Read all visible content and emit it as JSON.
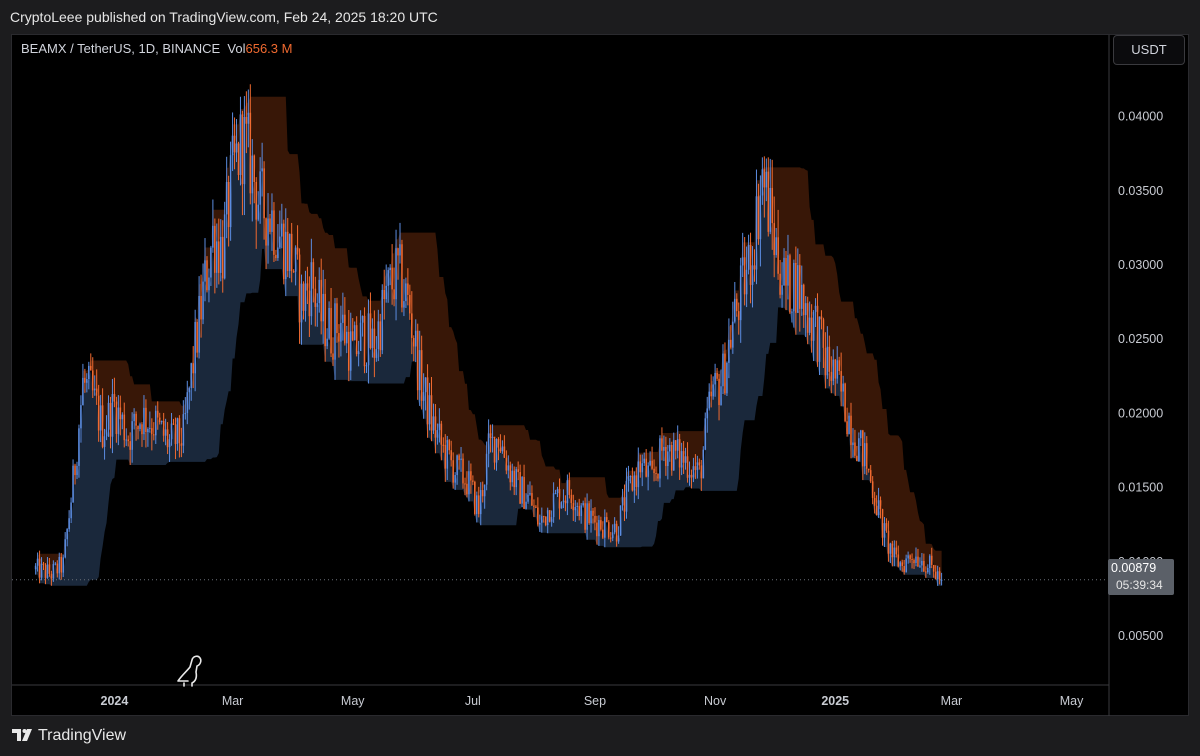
{
  "header": {
    "published_text": "CryptoLeee published on TradingView.com, Feb 24, 2025 18:20 UTC"
  },
  "legend": {
    "symbol": "BEAMX / TetherUS, 1D, BINANCE",
    "vol_label": "Vol",
    "vol_value": "656.3 M"
  },
  "currency_button": "USDT",
  "last_price": {
    "value": "0.00879",
    "countdown": "05:39:34"
  },
  "footer": {
    "brand": "TradingView"
  },
  "colors": {
    "up_candle": "#5b8ce0",
    "down_candle": "#f06a30",
    "lower_band": "#1b2a3e",
    "upper_band": "#3e1a08",
    "background": "#000000"
  },
  "chart_data": {
    "type": "candlestick",
    "symbol": "BEAMX / TetherUS",
    "timeframe": "1D",
    "exchange": "BINANCE",
    "y_axis_labels": [
      "0.04000",
      "0.03500",
      "0.03000",
      "0.02500",
      "0.02000",
      "0.01500",
      "0.01000",
      "0.00500"
    ],
    "y_axis_values": [
      0.04,
      0.035,
      0.03,
      0.025,
      0.02,
      0.015,
      0.01,
      0.005
    ],
    "ylim": [
      0.0017,
      0.0455
    ],
    "x_axis_labels": [
      "2024",
      "Mar",
      "May",
      "Jul",
      "Sep",
      "Nov",
      "2025",
      "Mar",
      "May"
    ],
    "x_axis_bold": [
      true,
      false,
      false,
      false,
      false,
      false,
      true,
      false,
      false
    ],
    "x_range": [
      "2023-11-10",
      "2025-05-20"
    ],
    "x_label_dates": [
      "2024-01-01",
      "2024-03-01",
      "2024-05-01",
      "2024-07-01",
      "2024-09-01",
      "2024-11-01",
      "2025-01-01",
      "2025-03-01",
      "2025-05-01"
    ],
    "close_series": [
      [
        "2023-11-22",
        0.0095
      ],
      [
        "2023-11-30",
        0.0092
      ],
      [
        "2023-12-06",
        0.0098
      ],
      [
        "2023-12-12",
        0.0165
      ],
      [
        "2023-12-16",
        0.022
      ],
      [
        "2023-12-20",
        0.0215
      ],
      [
        "2023-12-26",
        0.019
      ],
      [
        "2024-01-01",
        0.0205
      ],
      [
        "2024-01-08",
        0.0185
      ],
      [
        "2024-01-15",
        0.0198
      ],
      [
        "2024-01-22",
        0.0192
      ],
      [
        "2024-01-29",
        0.018
      ],
      [
        "2024-02-05",
        0.0185
      ],
      [
        "2024-02-10",
        0.0235
      ],
      [
        "2024-02-15",
        0.028
      ],
      [
        "2024-02-20",
        0.032
      ],
      [
        "2024-02-25",
        0.031
      ],
      [
        "2024-03-01",
        0.036
      ],
      [
        "2024-03-06",
        0.0385
      ],
      [
        "2024-03-10",
        0.037
      ],
      [
        "2024-03-15",
        0.034
      ],
      [
        "2024-03-20",
        0.0335
      ],
      [
        "2024-03-25",
        0.032
      ],
      [
        "2024-03-31",
        0.0305
      ],
      [
        "2024-04-05",
        0.0275
      ],
      [
        "2024-04-10",
        0.029
      ],
      [
        "2024-04-15",
        0.0265
      ],
      [
        "2024-04-20",
        0.0255
      ],
      [
        "2024-04-25",
        0.0262
      ],
      [
        "2024-05-01",
        0.024
      ],
      [
        "2024-05-06",
        0.0252
      ],
      [
        "2024-05-12",
        0.0245
      ],
      [
        "2024-05-18",
        0.028
      ],
      [
        "2024-05-24",
        0.0295
      ],
      [
        "2024-05-30",
        0.027
      ],
      [
        "2024-06-04",
        0.0225
      ],
      [
        "2024-06-10",
        0.0195
      ],
      [
        "2024-06-16",
        0.0175
      ],
      [
        "2024-06-22",
        0.0162
      ],
      [
        "2024-06-28",
        0.0155
      ],
      [
        "2024-07-04",
        0.0135
      ],
      [
        "2024-07-09",
        0.0175
      ],
      [
        "2024-07-14",
        0.0185
      ],
      [
        "2024-07-19",
        0.0165
      ],
      [
        "2024-07-24",
        0.015
      ],
      [
        "2024-07-30",
        0.0142
      ],
      [
        "2024-08-04",
        0.0125
      ],
      [
        "2024-08-09",
        0.0138
      ],
      [
        "2024-08-14",
        0.0145
      ],
      [
        "2024-08-20",
        0.0148
      ],
      [
        "2024-08-26",
        0.0132
      ],
      [
        "2024-08-31",
        0.0128
      ],
      [
        "2024-09-06",
        0.0125
      ],
      [
        "2024-09-12",
        0.0122
      ],
      [
        "2024-09-18",
        0.0148
      ],
      [
        "2024-09-24",
        0.0165
      ],
      [
        "2024-09-30",
        0.0155
      ],
      [
        "2024-10-06",
        0.0178
      ],
      [
        "2024-10-12",
        0.0172
      ],
      [
        "2024-10-18",
        0.0168
      ],
      [
        "2024-10-24",
        0.0158
      ],
      [
        "2024-10-30",
        0.021
      ],
      [
        "2024-11-05",
        0.0225
      ],
      [
        "2024-11-10",
        0.026
      ],
      [
        "2024-11-15",
        0.0285
      ],
      [
        "2024-11-20",
        0.031
      ],
      [
        "2024-11-25",
        0.036
      ],
      [
        "2024-11-28",
        0.034
      ],
      [
        "2024-12-02",
        0.031
      ],
      [
        "2024-12-07",
        0.0285
      ],
      [
        "2024-12-12",
        0.029
      ],
      [
        "2024-12-17",
        0.027
      ],
      [
        "2024-12-22",
        0.026
      ],
      [
        "2024-12-27",
        0.0235
      ],
      [
        "2025-01-01",
        0.0225
      ],
      [
        "2025-01-06",
        0.0205
      ],
      [
        "2025-01-11",
        0.0185
      ],
      [
        "2025-01-16",
        0.017
      ],
      [
        "2025-01-21",
        0.0145
      ],
      [
        "2025-01-26",
        0.0118
      ],
      [
        "2025-01-31",
        0.0102
      ],
      [
        "2025-02-04",
        0.0098
      ],
      [
        "2025-02-09",
        0.0105
      ],
      [
        "2025-02-14",
        0.0102
      ],
      [
        "2025-02-19",
        0.0095
      ],
      [
        "2025-02-24",
        0.00879
      ]
    ]
  }
}
